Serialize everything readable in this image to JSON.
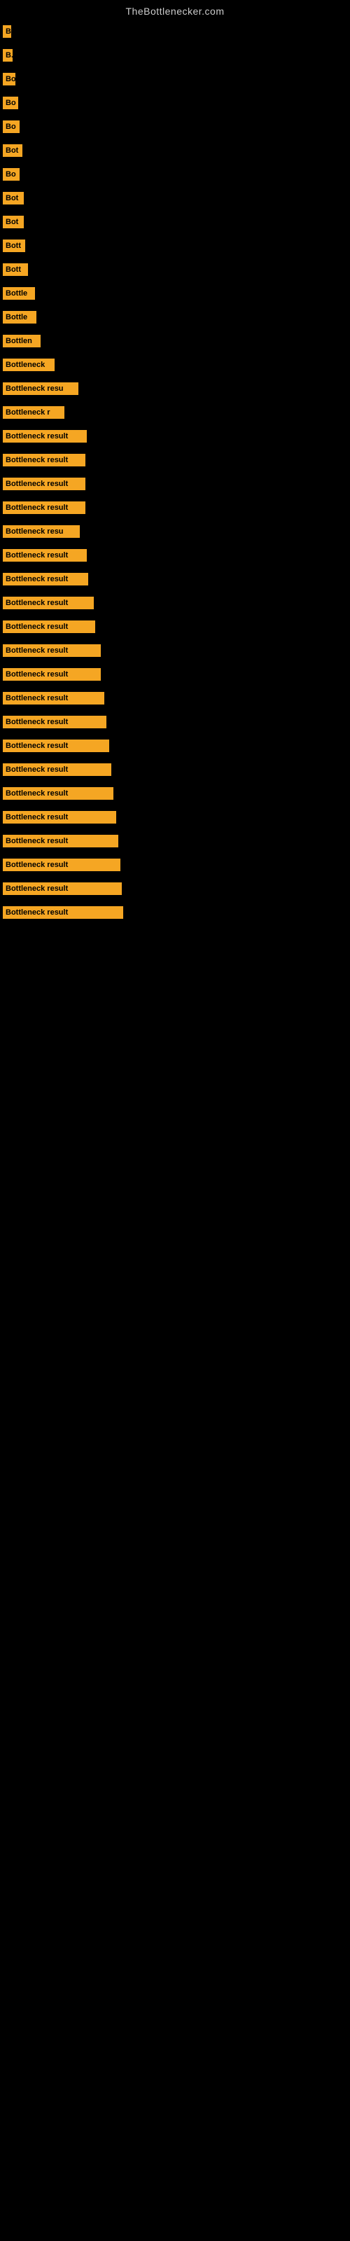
{
  "site_title": "TheBottlenecker.com",
  "bars": [
    {
      "label": "B",
      "width": 12
    },
    {
      "label": "B.",
      "width": 14
    },
    {
      "label": "Bo",
      "width": 18
    },
    {
      "label": "Bo",
      "width": 22
    },
    {
      "label": "Bo",
      "width": 24
    },
    {
      "label": "Bot",
      "width": 28
    },
    {
      "label": "Bo",
      "width": 24
    },
    {
      "label": "Bot",
      "width": 30
    },
    {
      "label": "Bot",
      "width": 30
    },
    {
      "label": "Bott",
      "width": 32
    },
    {
      "label": "Bott",
      "width": 36
    },
    {
      "label": "Bottle",
      "width": 46
    },
    {
      "label": "Bottle",
      "width": 48
    },
    {
      "label": "Bottlen",
      "width": 54
    },
    {
      "label": "Bottleneck",
      "width": 74
    },
    {
      "label": "Bottleneck resu",
      "width": 108
    },
    {
      "label": "Bottleneck r",
      "width": 88
    },
    {
      "label": "Bottleneck result",
      "width": 120
    },
    {
      "label": "Bottleneck result",
      "width": 118
    },
    {
      "label": "Bottleneck result",
      "width": 118
    },
    {
      "label": "Bottleneck result",
      "width": 118
    },
    {
      "label": "Bottleneck resu",
      "width": 110
    },
    {
      "label": "Bottleneck result",
      "width": 120
    },
    {
      "label": "Bottleneck result",
      "width": 122
    },
    {
      "label": "Bottleneck result",
      "width": 130
    },
    {
      "label": "Bottleneck result",
      "width": 132
    },
    {
      "label": "Bottleneck result",
      "width": 140
    },
    {
      "label": "Bottleneck result",
      "width": 140
    },
    {
      "label": "Bottleneck result",
      "width": 145
    },
    {
      "label": "Bottleneck result",
      "width": 148
    },
    {
      "label": "Bottleneck result",
      "width": 152
    },
    {
      "label": "Bottleneck result",
      "width": 155
    },
    {
      "label": "Bottleneck result",
      "width": 158
    },
    {
      "label": "Bottleneck result",
      "width": 162
    },
    {
      "label": "Bottleneck result",
      "width": 165
    },
    {
      "label": "Bottleneck result",
      "width": 168
    },
    {
      "label": "Bottleneck result",
      "width": 170
    },
    {
      "label": "Bottleneck result",
      "width": 172
    }
  ]
}
